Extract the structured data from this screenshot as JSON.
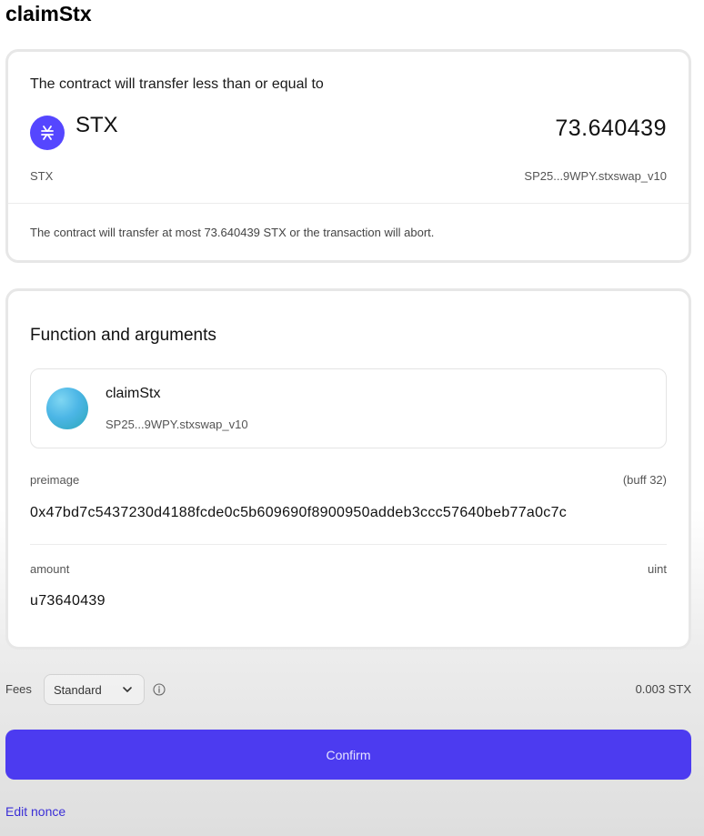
{
  "page": {
    "title": "claimStx"
  },
  "transfer": {
    "heading": "The contract will transfer less than or equal to",
    "token_icon": "stacks-icon",
    "token_symbol": "STX",
    "amount": "73.640439",
    "token_subtitle": "STX",
    "contract": "SP25...9WPY.stxswap_v10",
    "note": "The contract will transfer at most 73.640439 STX or the transaction will abort."
  },
  "function": {
    "heading": "Function and arguments",
    "name": "claimStx",
    "contract": "SP25...9WPY.stxswap_v10",
    "args": [
      {
        "name": "preimage",
        "type": "(buff 32)",
        "value": "0x47bd7c5437230d4188fcde0c5b609690f8900950addeb3ccc57640beb77a0c7c"
      },
      {
        "name": "amount",
        "type": "uint",
        "value": "u73640439"
      }
    ]
  },
  "fees": {
    "label": "Fees",
    "selected": "Standard",
    "amount": "0.003 STX"
  },
  "actions": {
    "confirm_label": "Confirm",
    "edit_nonce_label": "Edit nonce"
  },
  "colors": {
    "accent": "#4c3bf0",
    "stacks_brand": "#5546ff"
  }
}
